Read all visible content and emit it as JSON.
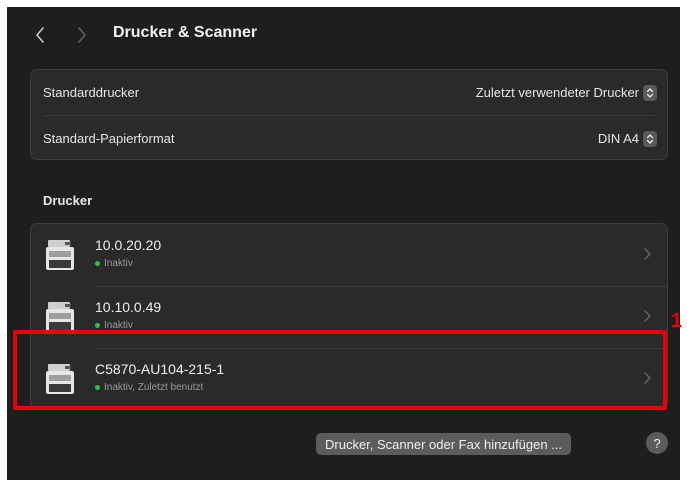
{
  "window": {
    "title": "Drucker & Scanner"
  },
  "settings": [
    {
      "label": "Standarddrucker",
      "value": "Zuletzt verwendeter Drucker"
    },
    {
      "label": "Standard-Papierformat",
      "value": "DIN A4"
    }
  ],
  "printers_section": {
    "title": "Drucker"
  },
  "printers": [
    {
      "name": "10.0.20.20",
      "status": "Inaktiv"
    },
    {
      "name": "10.10.0.49",
      "status": "Inaktiv"
    },
    {
      "name": "C5870-AU104-215-1",
      "status": "Inaktiv, Zuletzt benutzt"
    }
  ],
  "annotation": {
    "marker_label": "1",
    "color": "#e8000b"
  },
  "footer": {
    "add_button_label": "Drucker, Scanner oder Fax hinzufügen ...",
    "help_label": "?"
  },
  "colors": {
    "background": "#1e1e1e",
    "group": "#2a2a2a",
    "status_active": "#29c43f"
  }
}
